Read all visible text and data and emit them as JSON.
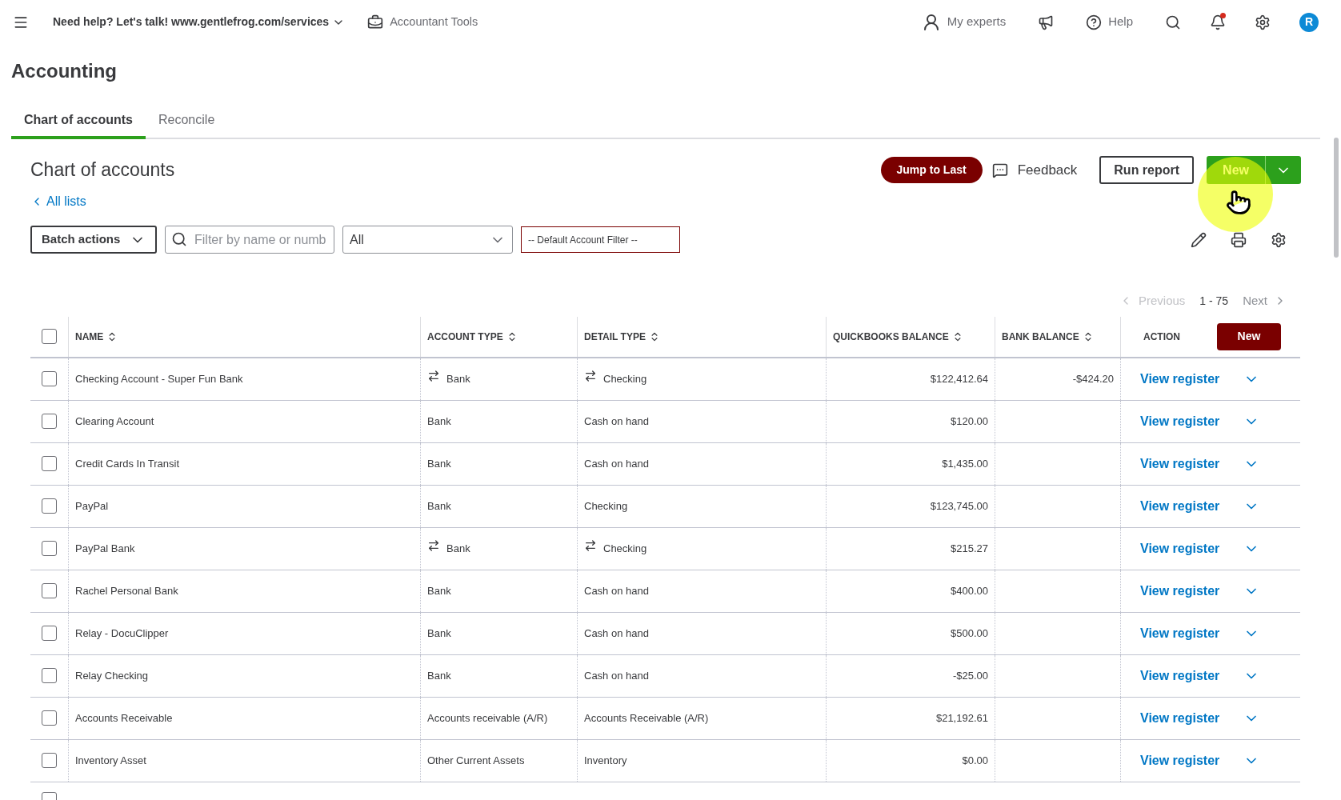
{
  "topbar": {
    "company": "Need help? Let's talk! www.gentlefrog.com/services",
    "tools": "Accountant Tools",
    "experts": "My experts",
    "help": "Help",
    "avatar": "R",
    "notification": true
  },
  "page_title": "Accounting",
  "tabs": [
    {
      "label": "Chart of accounts",
      "selected": true
    },
    {
      "label": "Reconcile",
      "selected": false
    }
  ],
  "section_title": "Chart of accounts",
  "back_link": "All lists",
  "buttons": {
    "jump": "Jump to Last",
    "feedback": "Feedback",
    "run_report": "Run report",
    "new": "New"
  },
  "filters": {
    "batch": "Batch actions",
    "search_placeholder": "Filter by name or numb",
    "type": "All",
    "default_filter": "-- Default Account Filter --"
  },
  "pagination": {
    "previous": "Previous",
    "range": "1 - 75",
    "next": "Next"
  },
  "table": {
    "select_all": {
      "checked": false
    },
    "partial_row": {
      "checked": false
    },
    "columns": [
      "NAME",
      "ACCOUNT TYPE",
      "DETAIL TYPE",
      "QUICKBOOKS BALANCE",
      "BANK BALANCE",
      "ACTION"
    ],
    "new_button": "New",
    "rows": [
      {
        "name": "Checking Account - Super Fun Bank",
        "account_type": "Bank",
        "detail_type": "Checking",
        "qb_balance": "$122,412.64",
        "bank_balance": "-$424.20",
        "action": "View register",
        "linked": true,
        "checked": false
      },
      {
        "name": "Clearing Account",
        "account_type": "Bank",
        "detail_type": "Cash on hand",
        "qb_balance": "$120.00",
        "action": "View register",
        "linked": false,
        "checked": false
      },
      {
        "name": "Credit Cards In Transit",
        "account_type": "Bank",
        "detail_type": "Cash on hand",
        "qb_balance": "$1,435.00",
        "action": "View register",
        "linked": false,
        "checked": false
      },
      {
        "name": "PayPal",
        "account_type": "Bank",
        "detail_type": "Checking",
        "qb_balance": "$123,745.00",
        "action": "View register",
        "linked": false,
        "checked": false
      },
      {
        "name": "PayPal Bank",
        "account_type": "Bank",
        "detail_type": "Checking",
        "qb_balance": "$215.27",
        "action": "View register",
        "linked": true,
        "checked": false
      },
      {
        "name": "Rachel Personal Bank",
        "account_type": "Bank",
        "detail_type": "Cash on hand",
        "qb_balance": "$400.00",
        "action": "View register",
        "linked": false,
        "checked": false
      },
      {
        "name": "Relay - DocuClipper",
        "account_type": "Bank",
        "detail_type": "Cash on hand",
        "qb_balance": "$500.00",
        "action": "View register",
        "linked": false,
        "checked": false
      },
      {
        "name": "Relay Checking",
        "account_type": "Bank",
        "detail_type": "Cash on hand",
        "qb_balance": "-$25.00",
        "action": "View register",
        "linked": false,
        "checked": false
      },
      {
        "name": "Accounts Receivable",
        "account_type": "Accounts receivable (A/R)",
        "detail_type": "Accounts Receivable (A/R)",
        "qb_balance": "$21,192.61",
        "action": "View register",
        "linked": false,
        "checked": false
      },
      {
        "name": "Inventory Asset",
        "account_type": "Other Current Assets",
        "detail_type": "Inventory",
        "qb_balance": "$0.00",
        "action": "View register",
        "linked": false,
        "checked": false
      }
    ]
  }
}
